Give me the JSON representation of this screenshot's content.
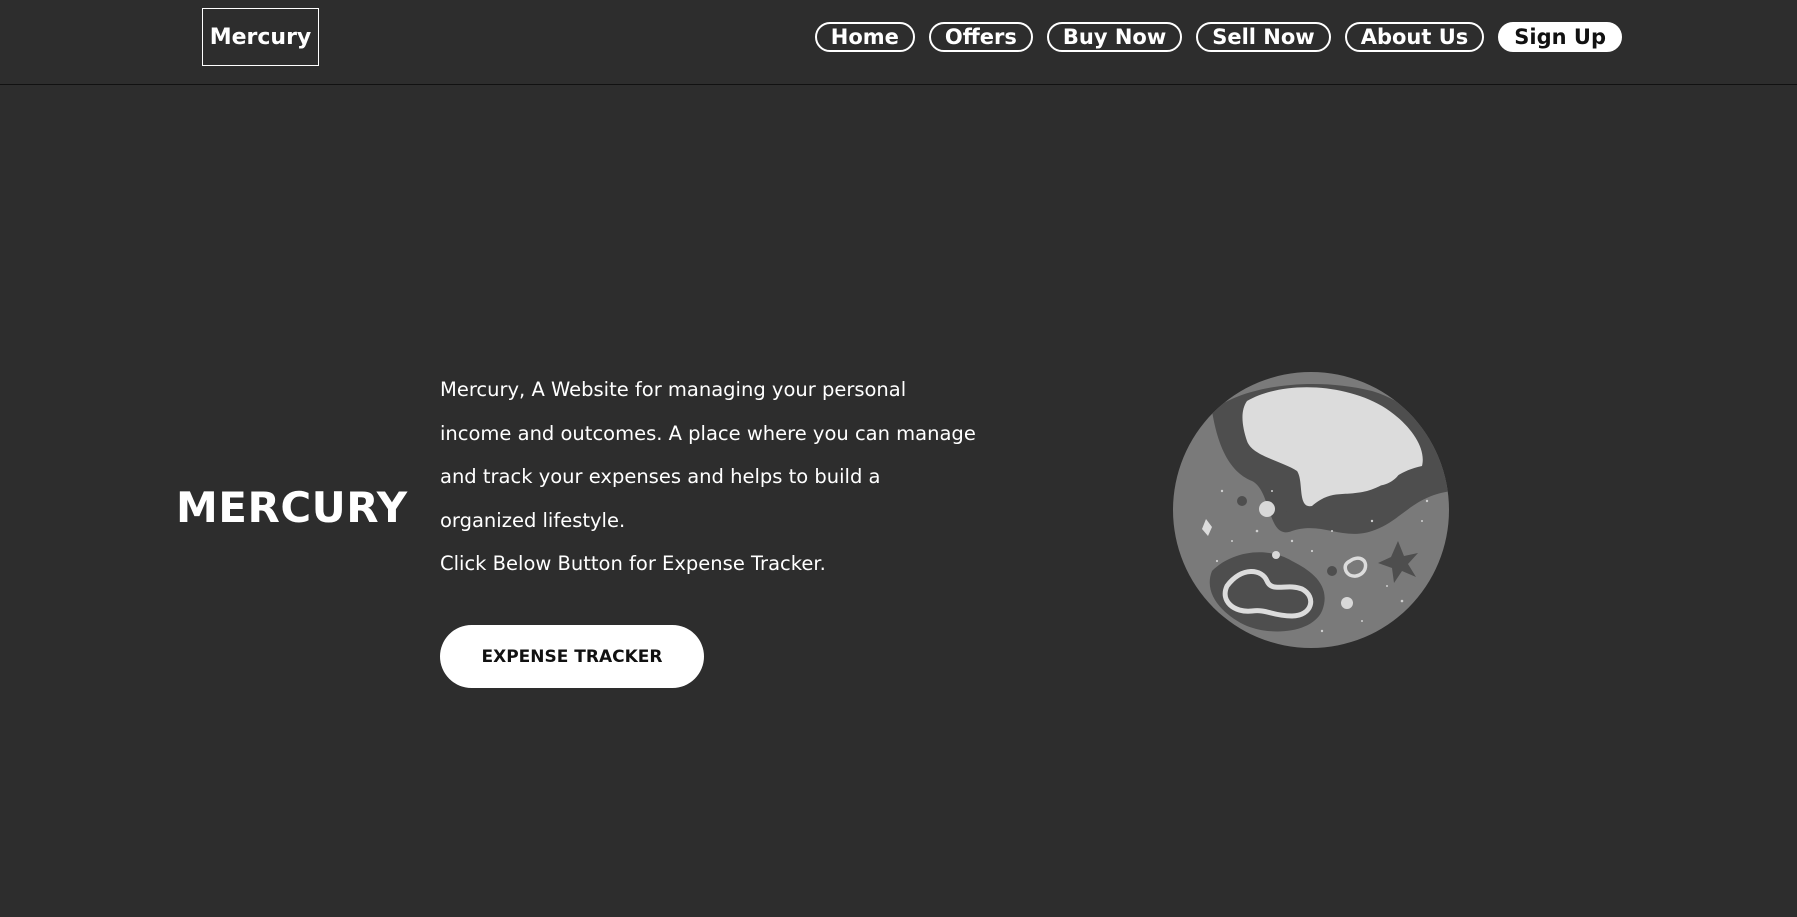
{
  "header": {
    "logo": "Mercury",
    "nav": [
      {
        "label": "Home"
      },
      {
        "label": "Offers"
      },
      {
        "label": "Buy Now"
      },
      {
        "label": "Sell Now"
      },
      {
        "label": "About Us"
      },
      {
        "label": "Sign Up"
      }
    ]
  },
  "hero": {
    "title": "MERCURY",
    "description": "Mercury, A Website for managing your personal income and outcomes. A place where you can manage and track your expenses and helps to build a organized lifestyle.",
    "instruction": "Click Below Button for Expense Tracker.",
    "cta_label": "EXPENSE TRACKER"
  },
  "icons": {
    "planet": "mercury-planet-illustration"
  },
  "colors": {
    "background": "#2d2d2d",
    "text": "#ffffff",
    "button_fill": "#ffffff"
  }
}
